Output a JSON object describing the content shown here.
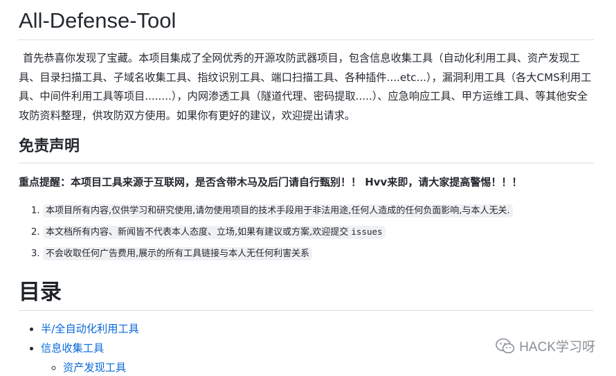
{
  "title": "All-Defense-Tool",
  "intro": "首先恭喜你发现了宝藏。本项目集成了全网优秀的开源攻防武器项目，包含信息收集工具（自动化利用工具、资产发现工具、目录扫描工具、子域名收集工具、指纹识别工具、端口扫描工具、各种插件....etc...），漏洞利用工具（各大CMS利用工具、中间件利用工具等项目........），内网渗透工具（隧道代理、密码提取.....）、应急响应工具、甲方运维工具、等其他安全攻防资料整理，供攻防双方使用。如果你有更好的建议，欢迎提出请求。",
  "disclaimer": {
    "heading": "免责声明",
    "warning": "重点提醒：本项目工具来源于互联网，是否含带木马及后门请自行甄别！！ Hvv来即，请大家提高警惕！！！",
    "notes": [
      {
        "text": "本项目所有内容,仅供学习和研究使用,请勿使用项目的技术手段用于非法用途,任何人造成的任何负面影响,与本人无关."
      },
      {
        "text": "本文档所有内容、新闻皆不代表本人态度、立场,如果有建议或方案,欢迎提交 ",
        "code": "issues"
      },
      {
        "text": "不会收取任何广告费用,展示的所有工具链接与本人无任何利害关系"
      }
    ]
  },
  "toc": {
    "heading": "目录",
    "items": [
      {
        "label": "半/全自动化利用工具"
      },
      {
        "label": "信息收集工具",
        "children": [
          {
            "label": "资产发现工具"
          }
        ]
      }
    ]
  },
  "watermark": {
    "text": "HACK学习呀",
    "icon": "wechat-icon"
  }
}
